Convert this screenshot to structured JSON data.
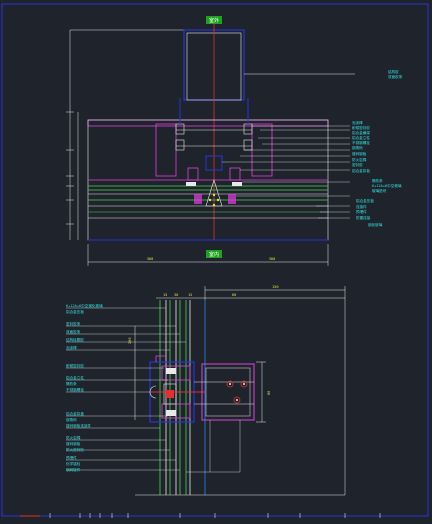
{
  "drawing": {
    "section_top": {
      "label_top": "室外",
      "label_bottom": "室内",
      "dim_left": "300",
      "dim_right": "300",
      "annotations_right": [
        "结构胶",
        "双面胶条",
        "泡沫棒",
        "耐候密封胶",
        "铝合金横梁",
        "铝合金立柱",
        "不锈钢螺栓",
        "钢角码",
        "镀锌钢板",
        "防火岩棉",
        "密封胶",
        "铝合金扣板",
        "隔热条",
        "6+12A+6中空玻璃",
        "玻璃垫块",
        "铝合金压板",
        "连接件",
        "预埋件",
        "防雷连接",
        "钢化玻璃"
      ]
    },
    "section_bottom": {
      "dim_top": [
        "15",
        "30",
        "15",
        "60",
        "150"
      ],
      "annotations_left": [
        "6+12A+6中空钢化玻璃",
        "铝合金压板",
        "密封胶条",
        "双面胶条",
        "结构硅酮胶",
        "泡沫棒",
        "耐候密封胶",
        "铝合金立柱",
        "隔热条",
        "不锈钢螺栓",
        "铝合金扣盖",
        "钢角码",
        "镀锌钢板连接件",
        "防火岩棉",
        "镀锌钢板",
        "防火密封胶",
        "预埋件",
        "化学锚栓",
        "钢转接件"
      ],
      "dim_side": "200",
      "dim_right": "80"
    },
    "colors": {
      "background": "#1f242c",
      "frame": "#2a34d8",
      "white_line": "#e8e8e8",
      "cyan": "#33e0e0",
      "magenta": "#e040e0",
      "green": "#50d050",
      "red": "#e03030",
      "yellow": "#e0e040",
      "label_box": "#20a020"
    }
  }
}
